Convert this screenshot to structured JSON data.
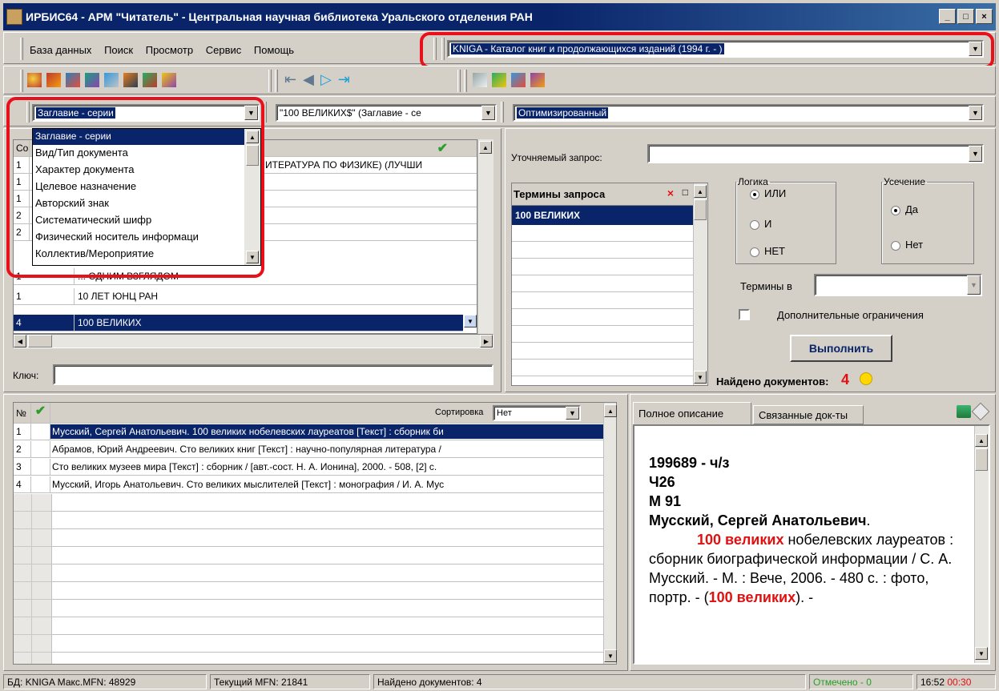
{
  "window": {
    "title": "ИРБИС64 - АРМ \"Читатель\" - Центральная научная библиотека Уральского отделения РАН",
    "min": "_",
    "max": "□",
    "close": "×"
  },
  "menu": [
    "База данных",
    "Поиск",
    "Просмотр",
    "Сервис",
    "Помощь"
  ],
  "database_combo": {
    "value": "KNIGA - Каталог книг и продолжающихся изданий (1994 г. - )"
  },
  "search_combo": {
    "value": "Заглавие - серии"
  },
  "query_combo": {
    "value": "\"100 ВЕЛИКИХ$\" (Заглавие - се"
  },
  "mode_combo": {
    "value": "Оптимизированный"
  },
  "dropdown": {
    "items": [
      "Заглавие - серии",
      "Вид/Тип документа",
      "Характер документа",
      "Целевое назначение",
      "Авторский знак",
      "Систематический шифр",
      "Физический носитель информаци",
      "Коллектив/Мероприятие"
    ]
  },
  "dictionary": {
    "header_col": "Со",
    "rows": [
      {
        "n": "1",
        "term": "ИТЕРАТУРА ПО ФИЗИКЕ) (ЛУЧШИ"
      },
      {
        "n": "1",
        "term": ""
      },
      {
        "n": "1",
        "term": ""
      },
      {
        "n": "2",
        "term": ""
      },
      {
        "n": "2",
        "term": ""
      },
      {
        "n": "1",
        "term": "... ОДНИМ ВЗГЛЯДОМ"
      },
      {
        "n": "1",
        "term": "10 ЛЕТ ЮНЦ РАН"
      },
      {
        "n": "4",
        "term": "100 ВЕЛИКИХ"
      }
    ],
    "key_label": "Ключ:"
  },
  "refine": {
    "label": "Уточняемый запрос:"
  },
  "terms": {
    "header": "Термины запроса",
    "items": [
      "100 ВЕЛИКИХ"
    ]
  },
  "logic": {
    "legend": "Логика",
    "options": [
      "ИЛИ",
      "И",
      "НЕТ"
    ],
    "selected": "ИЛИ"
  },
  "truncation": {
    "legend": "Усечение",
    "options": [
      "Да",
      "Нет"
    ],
    "selected": "Да"
  },
  "terms_in": {
    "label": "Термины в"
  },
  "extra": {
    "label": "Дополнительные ограничения"
  },
  "execute": {
    "label": "Выполнить"
  },
  "found": {
    "label": "Найдено документов:",
    "count": "4"
  },
  "results": {
    "header_num": "№",
    "sort_label": "Сортировка",
    "sort_value": "Нет",
    "rows": [
      {
        "n": "1",
        "text": "Мусский, Сергей Анатольевич. 100 великих нобелевских лауреатов [Текст] : сборник би"
      },
      {
        "n": "2",
        "text": "Абрамов, Юрий Андреевич. Сто великих книг [Текст] : научно-популярная литература /"
      },
      {
        "n": "3",
        "text": "Сто великих музеев мира [Текст] : сборник / [авт.-сост. Н. А. Ионина], 2000. - 508, [2] с."
      },
      {
        "n": "4",
        "text": "Мусский, Игорь Анатольевич. Сто великих мыслителей [Текст] : монография / И. А. Мус"
      }
    ]
  },
  "detail": {
    "tab1": "Полное описание",
    "tab2": "Связанные док-ты ...",
    "line1": "199689 - ч/з",
    "line2": "Ч26",
    "line3": "М 91",
    "author": "Мусский, Сергей Анатольевич",
    "highlight1": "100 великих",
    "body1": " нобелевских лауреатов : сборник биографической информации / С. А. Мусский. - М. : Вече, 2006. - 480 с. : фото, портр. - (",
    "highlight2": "100 великих",
    "body2": "). -"
  },
  "statusbar": {
    "db": "БД: KNIGA Макс.MFN: 48929",
    "mfn": "Текущий MFN: 21841",
    "found": "Найдено документов: 4",
    "marked": "Отмечено - 0",
    "time": "16:52",
    "timer": "00:30"
  }
}
